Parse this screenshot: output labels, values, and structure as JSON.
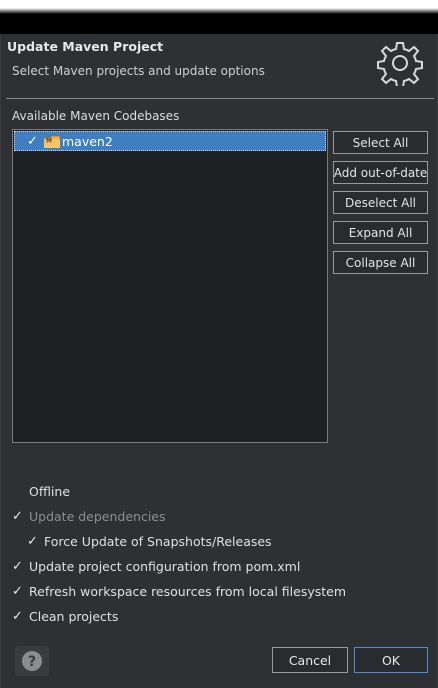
{
  "window": {
    "title": "Update Maven Project",
    "subtitle": "Select Maven projects and update options",
    "icon": "gear-icon"
  },
  "codebases": {
    "label": "Available Maven Codebases",
    "items": [
      {
        "label": "maven2",
        "checked": true,
        "selected": true,
        "icon": "maven-folder-icon"
      }
    ]
  },
  "side_buttons": {
    "select_all": "Select All",
    "add_out_of_date": "Add out-of-date",
    "deselect_all": "Deselect All",
    "expand_all": "Expand All",
    "collapse_all": "Collapse All"
  },
  "options": {
    "offline": {
      "label": "Offline",
      "checked": false
    },
    "update_dependencies": {
      "label": "Update dependencies",
      "checked": true,
      "enabled": false
    },
    "force_update": {
      "label": "Force Update of Snapshots/Releases",
      "checked": true
    },
    "update_config": {
      "label": "Update project configuration from pom.xml",
      "checked": true
    },
    "refresh_workspace": {
      "label": "Refresh workspace resources from local filesystem",
      "checked": true
    },
    "clean_projects": {
      "label": "Clean projects",
      "checked": true
    }
  },
  "footer": {
    "help_icon": "help-icon",
    "cancel": "Cancel",
    "ok": "OK"
  },
  "colors": {
    "dialog_bg": "#2f3033",
    "tree_bg": "#1f2023",
    "selection": "#3f7fc1",
    "default_button_border": "#4a8fd6"
  }
}
